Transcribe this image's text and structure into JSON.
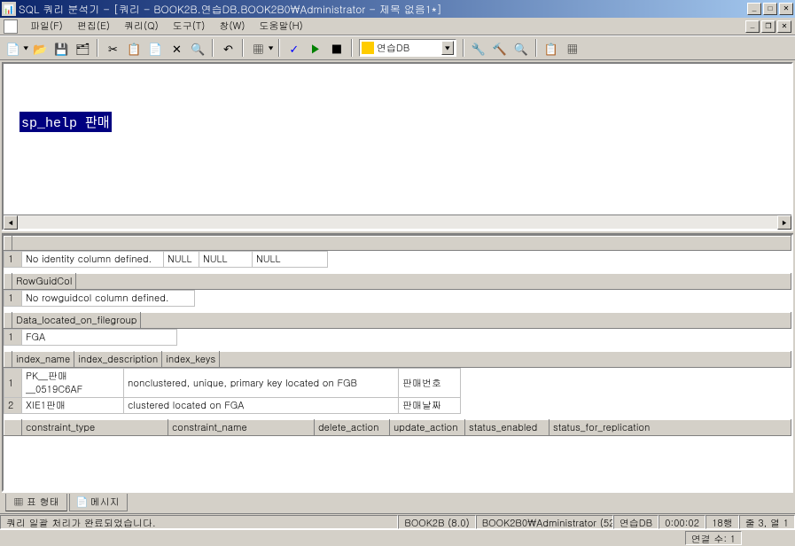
{
  "title": "SQL 쿼리 분석기 - [쿼리 - BOOK2B.연습DB.BOOK2B0\\Administrator - 제목 없음1*]",
  "menu": {
    "file": "파일(F)",
    "edit": "편집(E)",
    "query": "쿼리(Q)",
    "tool": "도구(T)",
    "window": "창(W)",
    "help": "도움말(H)"
  },
  "db_selected": "연습DB",
  "sql_text": "sp_help 판매",
  "section1": {
    "row_num": "1",
    "cells": [
      "No identity column defined.",
      "NULL",
      "NULL",
      "NULL"
    ]
  },
  "section2": {
    "header": "RowGuidCol",
    "row_num": "1",
    "cell": "No rowguidcol column defined."
  },
  "section3": {
    "header": "Data_located_on_filegroup",
    "row_num": "1",
    "cell": "FGA"
  },
  "section4": {
    "headers": [
      "index_name",
      "index_description",
      "index_keys"
    ],
    "rows": [
      {
        "num": "1",
        "name": "PK__판매__0519C6AF",
        "desc": "nonclustered, unique, primary key located on FGB",
        "keys": "판매번호"
      },
      {
        "num": "2",
        "name": "XIE1판매",
        "desc": "clustered located on FGA",
        "keys": "판매날짜"
      }
    ]
  },
  "section5": {
    "headers": [
      "constraint_type",
      "constraint_name",
      "delete_action",
      "update_action",
      "status_enabled",
      "status_for_replication"
    ]
  },
  "tabs": {
    "grid": "표 형태",
    "messages": "메시지"
  },
  "status": {
    "ready": "쿼리 일괄 처리가 완료되었습니다.",
    "server": "BOOK2B (8.0)",
    "user": "BOOK2B0\\Administrator (52",
    "db": "연습DB",
    "time": "0:00:02",
    "rows": "18행",
    "pos": "줄 3, 열 1",
    "connections": "연결 수: 1"
  }
}
